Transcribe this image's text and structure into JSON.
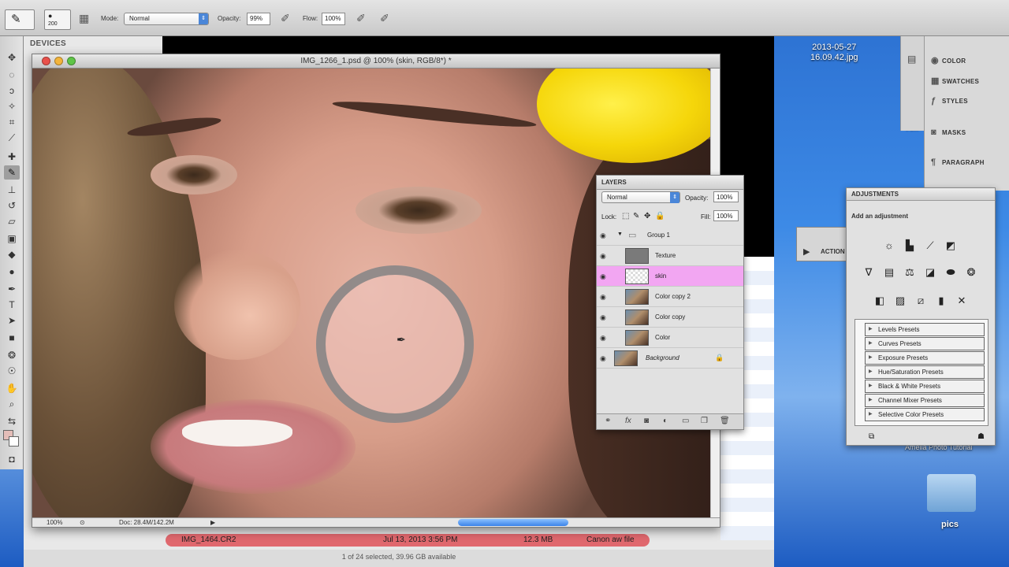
{
  "options_bar": {
    "brush_size": "200",
    "mode_label": "Mode:",
    "mode_value": "Normal",
    "opacity_label": "Opacity:",
    "opacity_value": "99%",
    "flow_label": "Flow:",
    "flow_value": "100%"
  },
  "bridge": {
    "devices_header": "DEVICES",
    "file_name": "IMG_1464.CR2",
    "file_date": "Jul 13, 2013 3:56 PM",
    "file_size": "12.3 MB",
    "file_type": "Canon   aw file",
    "status": "1 of 24 selected, 39.96 GB available"
  },
  "document": {
    "title": "IMG_1266_1.psd @ 100% (skin, RGB/8*) *",
    "zoom": "100%",
    "doc_size": "Doc: 28.4M/142.2M"
  },
  "dock": {
    "items": [
      {
        "label": "COLOR",
        "icon": "color-icon"
      },
      {
        "label": "SWATCHES",
        "icon": "swatches-icon"
      },
      {
        "label": "STYLES",
        "icon": "styles-icon"
      },
      {
        "label": "MASKS",
        "icon": "masks-icon"
      },
      {
        "label": "PARAGRAPH",
        "icon": "paragraph-icon"
      }
    ]
  },
  "layers_panel": {
    "title": "LAYERS",
    "blend_mode": "Normal",
    "opacity_label": "Opacity:",
    "opacity_value": "100%",
    "lock_label": "Lock:",
    "fill_label": "Fill:",
    "fill_value": "100%",
    "layers": [
      {
        "name": "Group 1",
        "type": "group",
        "selected": false
      },
      {
        "name": "Texture",
        "type": "gray",
        "selected": false
      },
      {
        "name": "skin",
        "type": "checker",
        "selected": true
      },
      {
        "name": "Color copy 2",
        "type": "photo",
        "selected": false
      },
      {
        "name": "Color copy",
        "type": "photo",
        "selected": false
      },
      {
        "name": "Color",
        "type": "photo",
        "selected": false
      },
      {
        "name": "Background",
        "type": "photo",
        "selected": false
      }
    ]
  },
  "adjustments_panel": {
    "title": "ADJUSTMENTS",
    "subtitle": "Add an adjustment",
    "presets": [
      "Levels Presets",
      "Curves Presets",
      "Exposure Presets",
      "Hue/Saturation Presets",
      "Black & White Presets",
      "Channel Mixer Presets",
      "Selective Color Presets"
    ]
  },
  "actions_panel": {
    "label": "ACTION"
  },
  "desktop": {
    "date_line1": "2013-05-27",
    "date_line2": "16.09.42.jpg",
    "side_text": "Am",
    "tutorial_text": "Amelia Photo Tutorial",
    "folder_label": "pics"
  },
  "colors": {
    "selected_layer": "#f2a6f2",
    "file_row": "#e0686e",
    "scroll_thumb": "#3b82e8",
    "foreground_swatch": "#e4bdb8"
  }
}
